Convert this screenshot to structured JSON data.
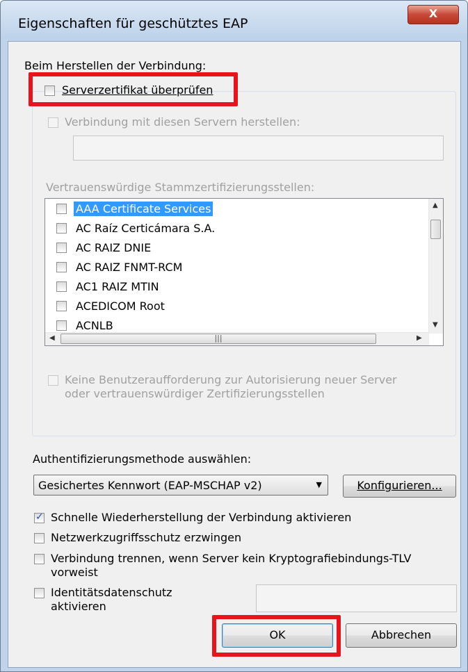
{
  "window": {
    "title": "Eigenschaften für geschütztes EAP",
    "close_label": "X"
  },
  "connect_section": {
    "label": "Beim Herstellen der Verbindung:",
    "verify_cert": {
      "label": "Serverzertifikat überprüfen",
      "checked": false
    },
    "connect_servers": {
      "label": "Verbindung mit diesen Servern herstellen:",
      "checked": false,
      "value": ""
    },
    "trusted_ca_label": "Vertrauenswürdige Stammzertifizierungsstellen:",
    "ca_list": [
      {
        "label": "AAA Certificate Services",
        "checked": false,
        "selected": true
      },
      {
        "label": "AC Raíz Certicámara S.A.",
        "checked": false,
        "selected": false
      },
      {
        "label": "AC RAIZ DNIE",
        "checked": false,
        "selected": false
      },
      {
        "label": "AC RAIZ FNMT-RCM",
        "checked": false,
        "selected": false
      },
      {
        "label": "AC1 RAIZ MTIN",
        "checked": false,
        "selected": false
      },
      {
        "label": "ACEDICOM Root",
        "checked": false,
        "selected": false
      },
      {
        "label": "ACNLB",
        "checked": false,
        "selected": false
      }
    ],
    "no_prompt": {
      "line1": "Keine Benutzeraufforderung zur Autorisierung neuer Server",
      "line2": "oder vertrauenswürdiger Zertifizierungsstellen",
      "checked": false
    }
  },
  "auth": {
    "label": "Authentifizierungsmethode auswählen:",
    "method_value": "Gesichertes Kennwort (EAP-MSCHAP v2)",
    "configure_label": "Konfigurieren..."
  },
  "options": {
    "fast_reconnect": {
      "label": "Schnelle Wiederherstellung der Verbindung aktivieren",
      "checked": true
    },
    "nap": {
      "label": "Netzwerkzugriffsschutz erzwingen",
      "checked": false
    },
    "crypto_binding": {
      "line1": "Verbindung trennen, wenn Server kein Kryptografiebindungs-TLV",
      "line2": "vorweist",
      "checked": false
    },
    "identity_privacy": {
      "line1": "Identitätsdatenschutz",
      "line2": "aktivieren",
      "checked": false,
      "value": ""
    }
  },
  "buttons": {
    "ok": "OK",
    "cancel": "Abbrechen"
  },
  "colors": {
    "highlight": "#e8141c",
    "selection": "#3399ff"
  }
}
